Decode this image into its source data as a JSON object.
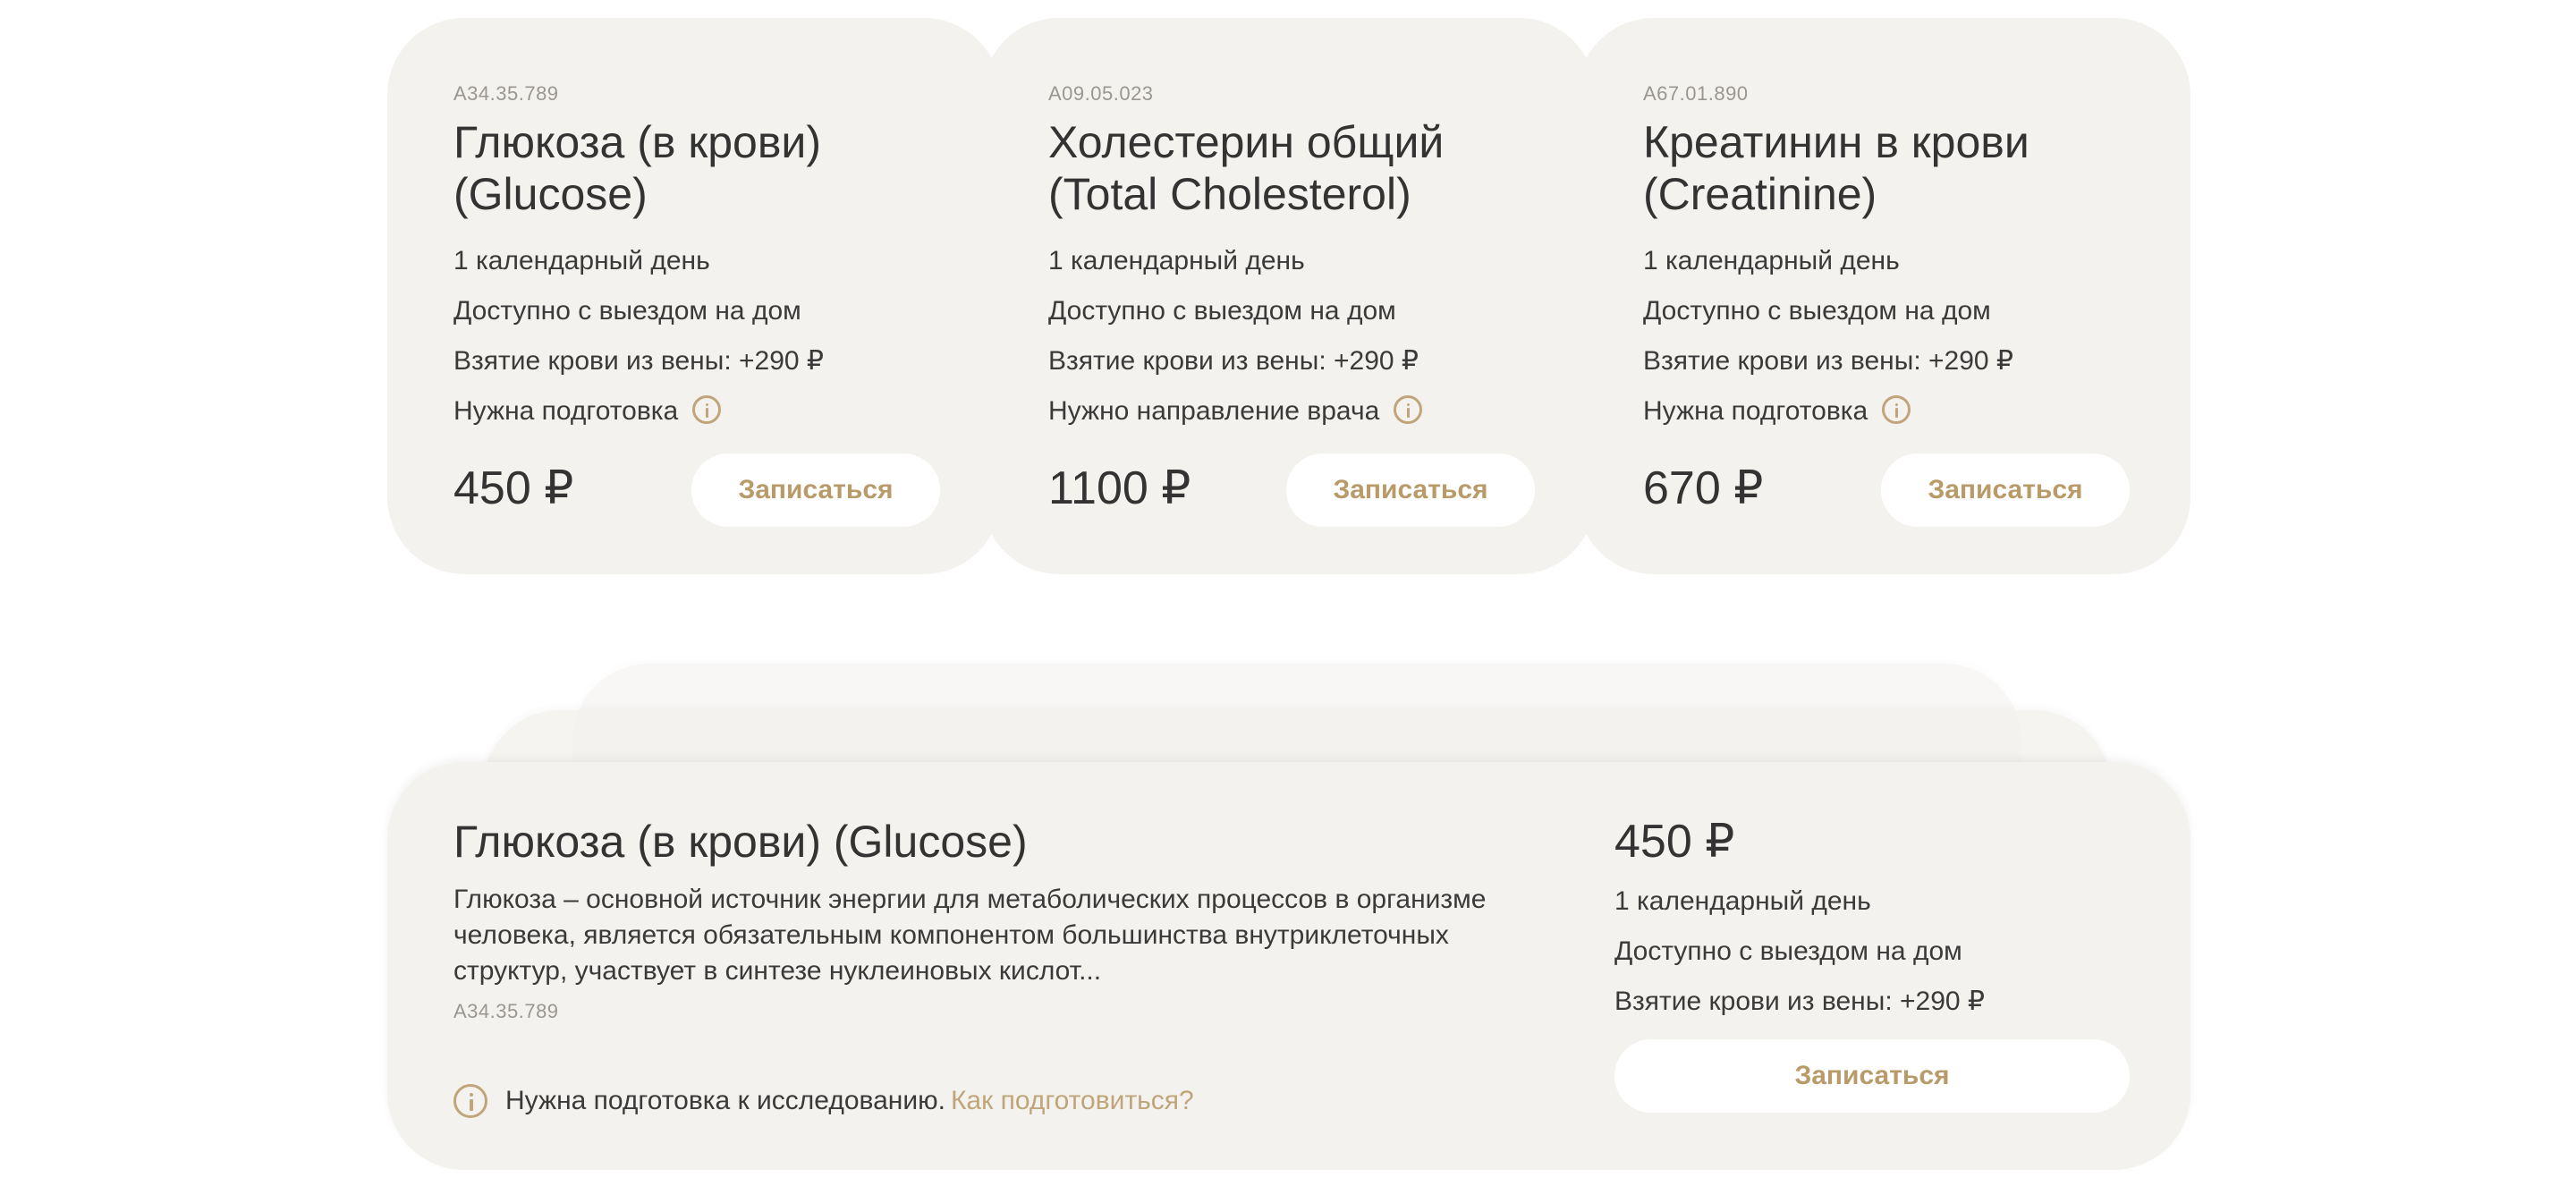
{
  "cards": [
    {
      "code": "A34.35.789",
      "title_line1": "Глюкоза (в крови)",
      "title_line2": "(Glucose)",
      "duration": "1 календарный день",
      "home": "Доступно с выездом на дом",
      "blood": "Взятие крови из вены: +290 ₽",
      "note": "Нужна подготовка",
      "price": "450 ₽",
      "button": "Записаться"
    },
    {
      "code": "A09.05.023",
      "title_line1": "Холестерин общий",
      "title_line2": "(Total Cholesterol)",
      "duration": "1 календарный день",
      "home": "Доступно с выездом на дом",
      "blood": "Взятие крови из вены: +290 ₽",
      "note": "Нужно направление врача",
      "price": "1100 ₽",
      "button": "Записаться"
    },
    {
      "code": "A67.01.890",
      "title_line1": "Креатинин в крови",
      "title_line2": "(Creatinine)",
      "duration": "1 календарный день",
      "home": "Доступно с выездом на дом",
      "blood": "Взятие крови из вены: +290 ₽",
      "note": "Нужна подготовка",
      "price": "670 ₽",
      "button": "Записаться"
    }
  ],
  "detail": {
    "title": "Глюкоза (в крови) (Glucose)",
    "description": "Глюкоза – основной источник энергии для метаболических процессов в организме человека, является обязательным компонентом большинства внутриклеточных структур, участвует в синтезе нуклеиновых кислот...",
    "code": "A34.35.789",
    "prep_text": "Нужна подготовка к исследованию.",
    "prep_link": "Как подготовиться?",
    "price": "450 ₽",
    "duration": "1 календарный день",
    "home": "Доступно с выездом на дом",
    "blood": "Взятие крови из вены: +290 ₽",
    "button": "Записаться"
  },
  "colors": {
    "card_bg": "#f4f2ee",
    "accent": "#b99b6a",
    "text": "#333333"
  },
  "icons": {
    "info": "info-circle-icon"
  }
}
